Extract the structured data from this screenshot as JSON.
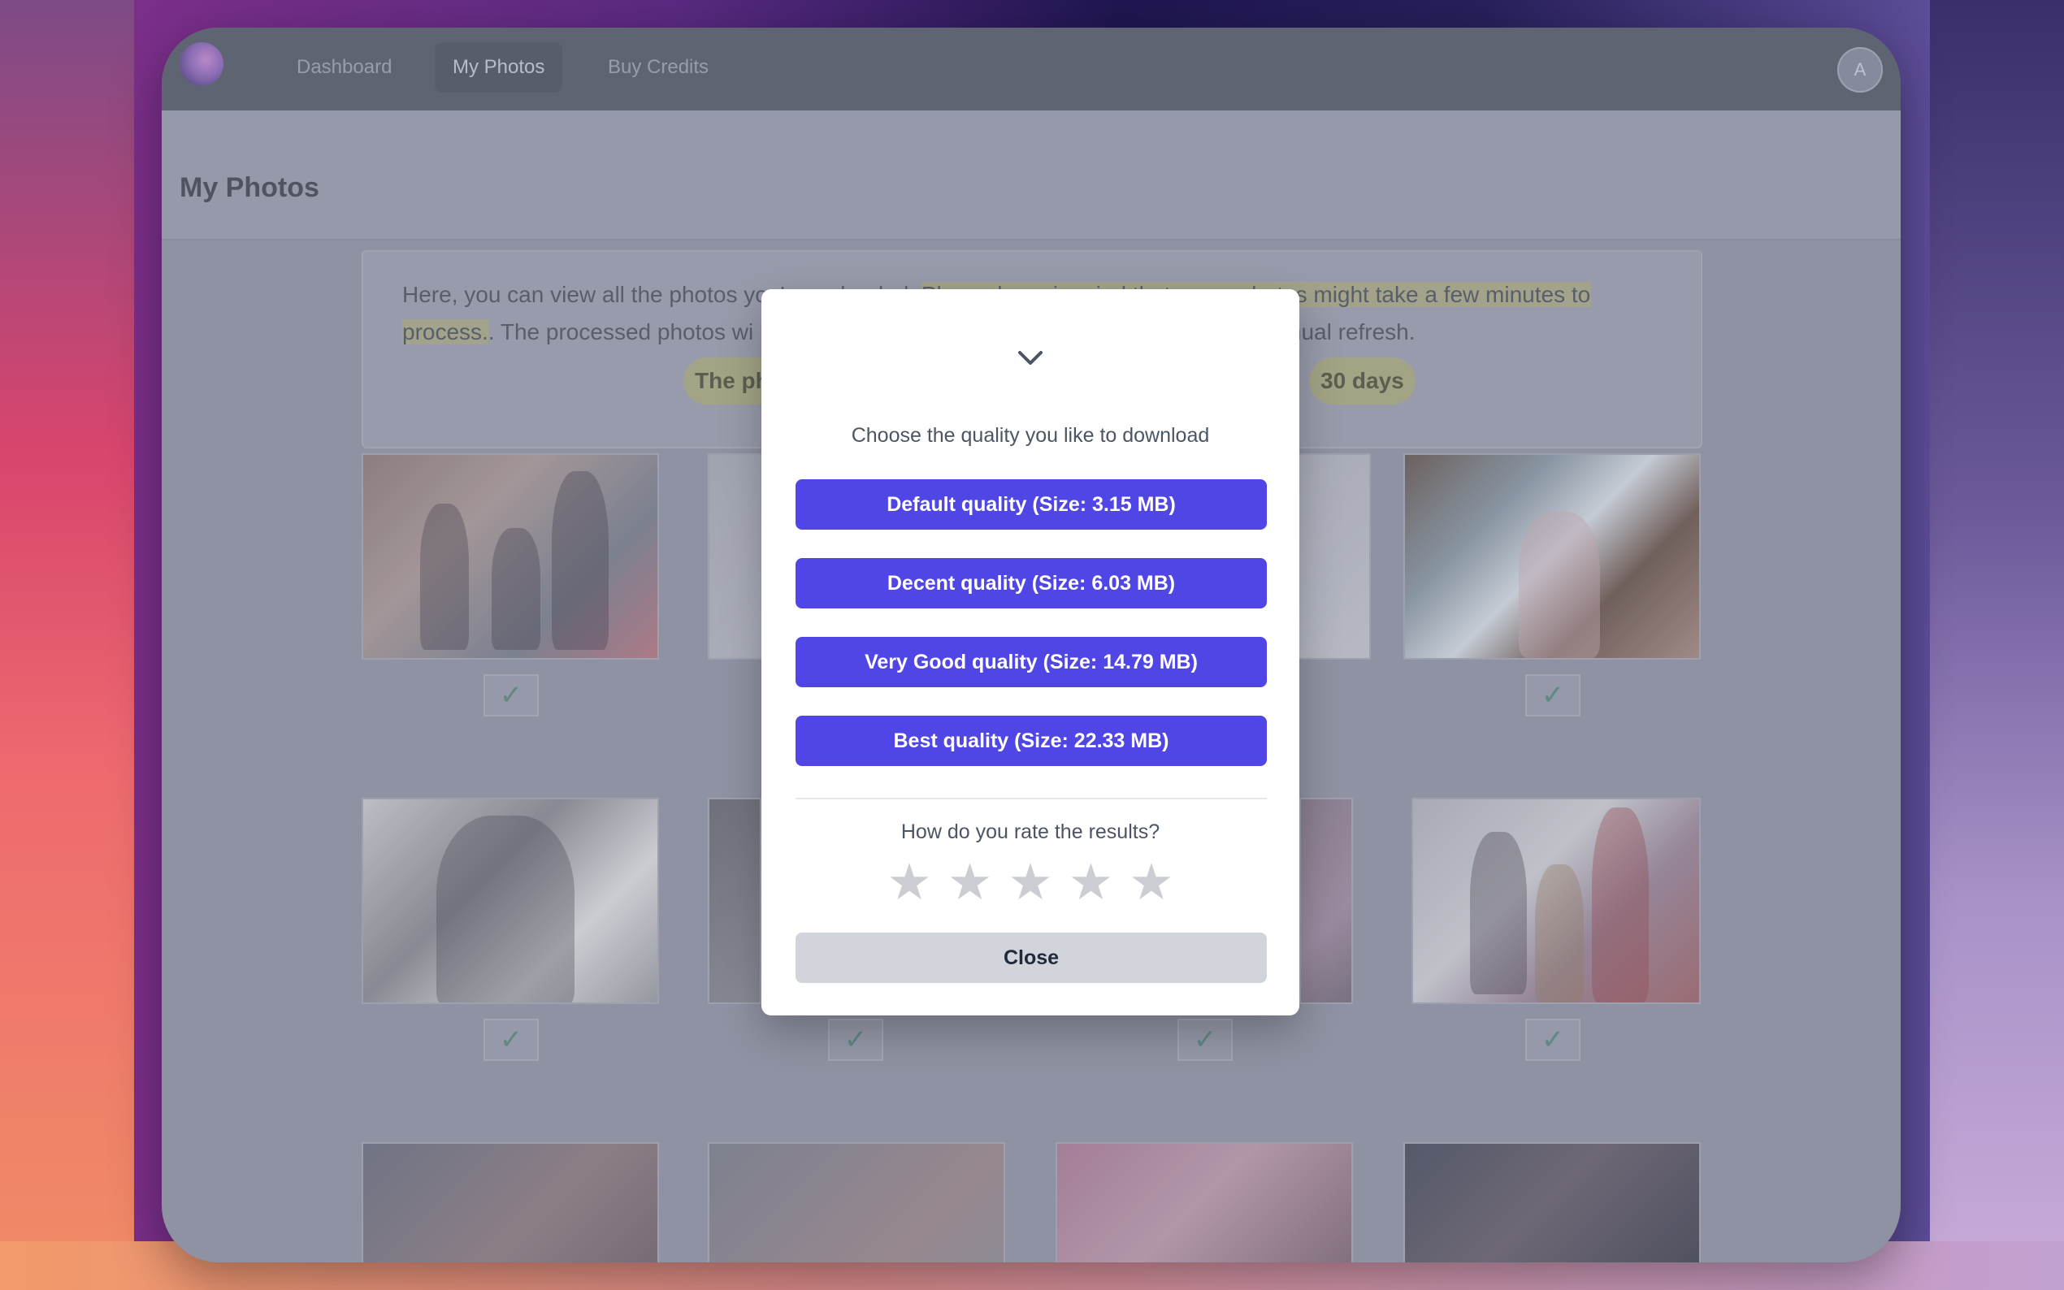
{
  "nav": {
    "items": [
      {
        "label": "Dashboard"
      },
      {
        "label": "My Photos"
      },
      {
        "label": "Buy Credits"
      }
    ],
    "avatar_initial": "A"
  },
  "page": {
    "title": "My Photos",
    "info_text_1": "Here, you can view all the photos you've uploaded. ",
    "info_text_highlight": "Please keep in mind that some photos might take a few minutes to process.",
    "info_text_2": ". The processed photos wi",
    "info_text_3": "manual refresh.",
    "pill_left": "The ph",
    "pill_right": "30 days"
  },
  "modal": {
    "collapse_icon": "chevron-down-icon",
    "prompt": "Choose the quality you like to download",
    "quality_buttons": [
      {
        "label": "Default quality (Size: 3.15 MB)"
      },
      {
        "label": "Decent quality (Size: 6.03 MB)"
      },
      {
        "label": "Very Good quality (Size: 14.79 MB)"
      },
      {
        "label": "Best quality (Size: 22.33 MB)"
      }
    ],
    "rating_prompt": "How do you rate the results?",
    "rating_max": 5,
    "rating_value": 0,
    "close_label": "Close"
  },
  "colors": {
    "primary_button": "#4f46e5",
    "close_button": "#d1d5db"
  }
}
